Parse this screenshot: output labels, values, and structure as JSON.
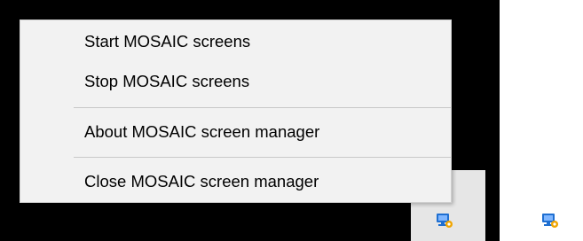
{
  "menu": {
    "items": [
      {
        "label": "Start MOSAIC screens"
      },
      {
        "label": "Stop MOSAIC screens"
      },
      {
        "label": "About MOSAIC screen manager"
      },
      {
        "label": "Close MOSAIC screen manager"
      }
    ]
  },
  "tray": {
    "icons": [
      {
        "name": "monitor-gear-icon",
        "state": "active"
      },
      {
        "name": "monitor-gear-icon",
        "state": "inactive"
      }
    ]
  },
  "colors": {
    "taskbar": "#000000",
    "menu_background": "#f2f2f2",
    "separator": "#c8c8c8",
    "tray_highlight": "#e6e6e6",
    "icon_blue": "#1f6fd1",
    "icon_gear": "#f0a500"
  }
}
